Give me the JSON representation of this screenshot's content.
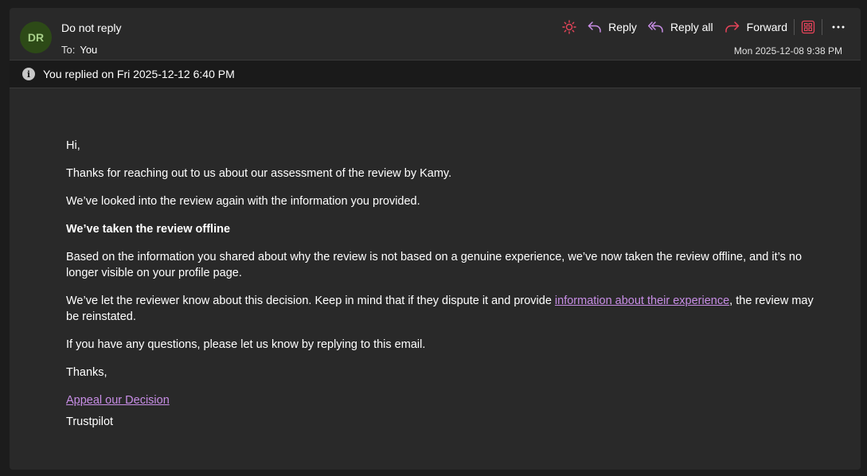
{
  "header": {
    "avatar_initials": "DR",
    "avatar_color": "#2d4a17",
    "sender": "Do not reply",
    "to_label": "To:",
    "to_value": "You",
    "date": "Mon 2025-12-08 9:38 PM",
    "actions": {
      "sun_icon": "sun-icon",
      "reply": "Reply",
      "reply_all": "Reply all",
      "forward": "Forward",
      "apps_icon": "apps-icon",
      "more_icon": "more-icon"
    }
  },
  "banner": {
    "text": "You replied on Fri 2025-12-12 6:40 PM"
  },
  "body": {
    "greeting": "Hi,",
    "p1": "Thanks for reaching out to us about our assessment of the review by Kamy.",
    "p2": "We’ve looked into the review again with the information you provided.",
    "heading": "We’ve taken the review offline",
    "p3": "Based on the information you shared about why the review is not based on a genuine experience, we’ve now taken the review offline, and it’s no longer visible on your profile page.",
    "p4_before": "We’ve let the reviewer know about this decision. Keep in mind that if they dispute it and provide ",
    "p4_link": "information about their experience",
    "p4_after": ", the review may be reinstated.",
    "p5": "If you have any questions, please let us know by replying to this email.",
    "thanks": "Thanks,",
    "appeal_link": "Appeal our Decision",
    "signature": "Trustpilot"
  },
  "colors": {
    "link": "#c88ee6",
    "accent_red": "#e8445a",
    "accent_purple": "#c88ee6"
  }
}
